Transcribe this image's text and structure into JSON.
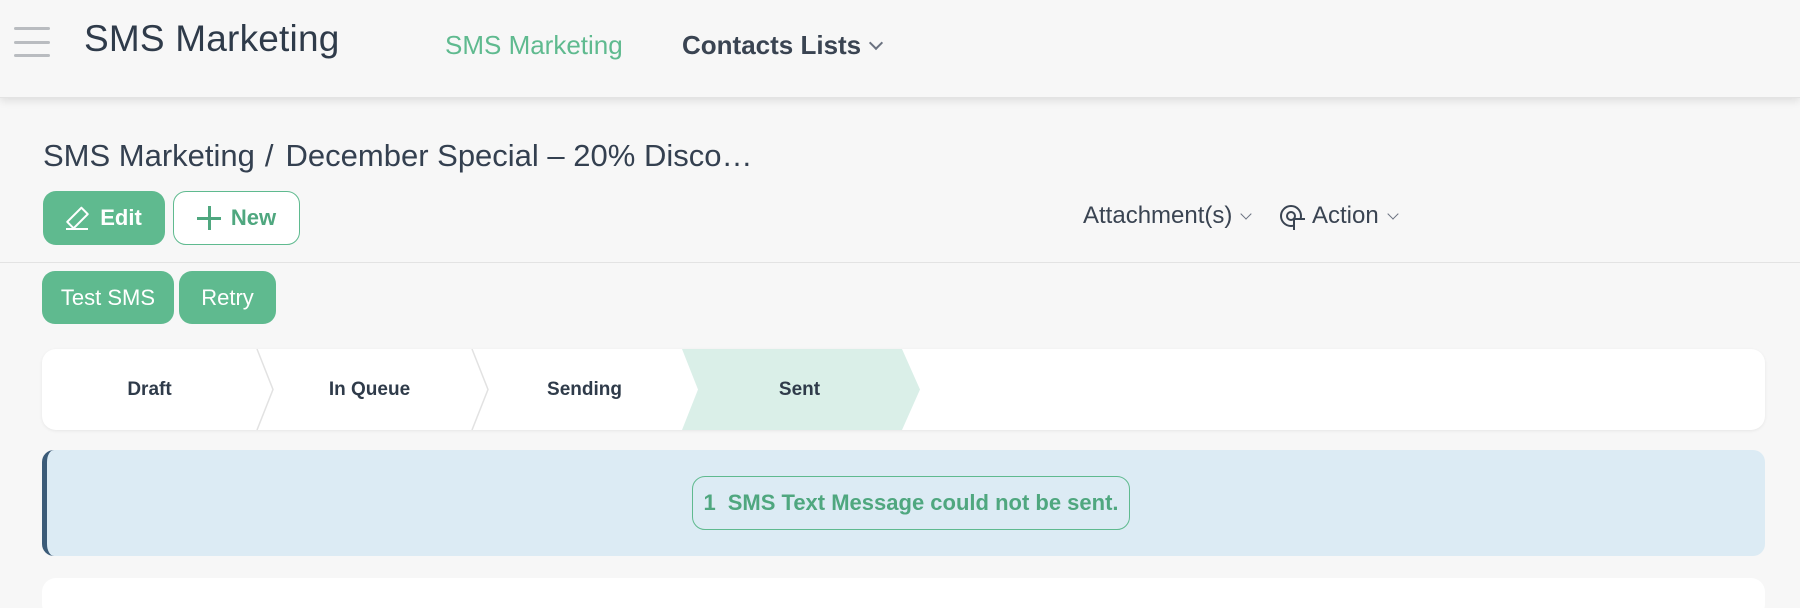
{
  "header": {
    "app_title": "SMS Marketing",
    "nav": {
      "sms_marketing": "SMS Marketing",
      "contacts_lists": "Contacts Lists"
    }
  },
  "breadcrumb": {
    "parent": "SMS Marketing",
    "separator": "/",
    "current": "December Special – 20% Disco…"
  },
  "toolbar": {
    "edit_label": "Edit",
    "new_label": "New",
    "attachments_label": "Attachment(s)",
    "action_label": "Action"
  },
  "buttons": {
    "test_sms": "Test SMS",
    "retry": "Retry"
  },
  "status": {
    "stages": [
      "Draft",
      "In Queue",
      "Sending",
      "Sent"
    ],
    "active": "Sent"
  },
  "alert": {
    "count": "1",
    "message": "SMS Text Message could not be sent."
  },
  "colors": {
    "accent": "#5fba8f",
    "alert_bg": "#dcebf4",
    "active_stage_bg": "#daefe8"
  }
}
